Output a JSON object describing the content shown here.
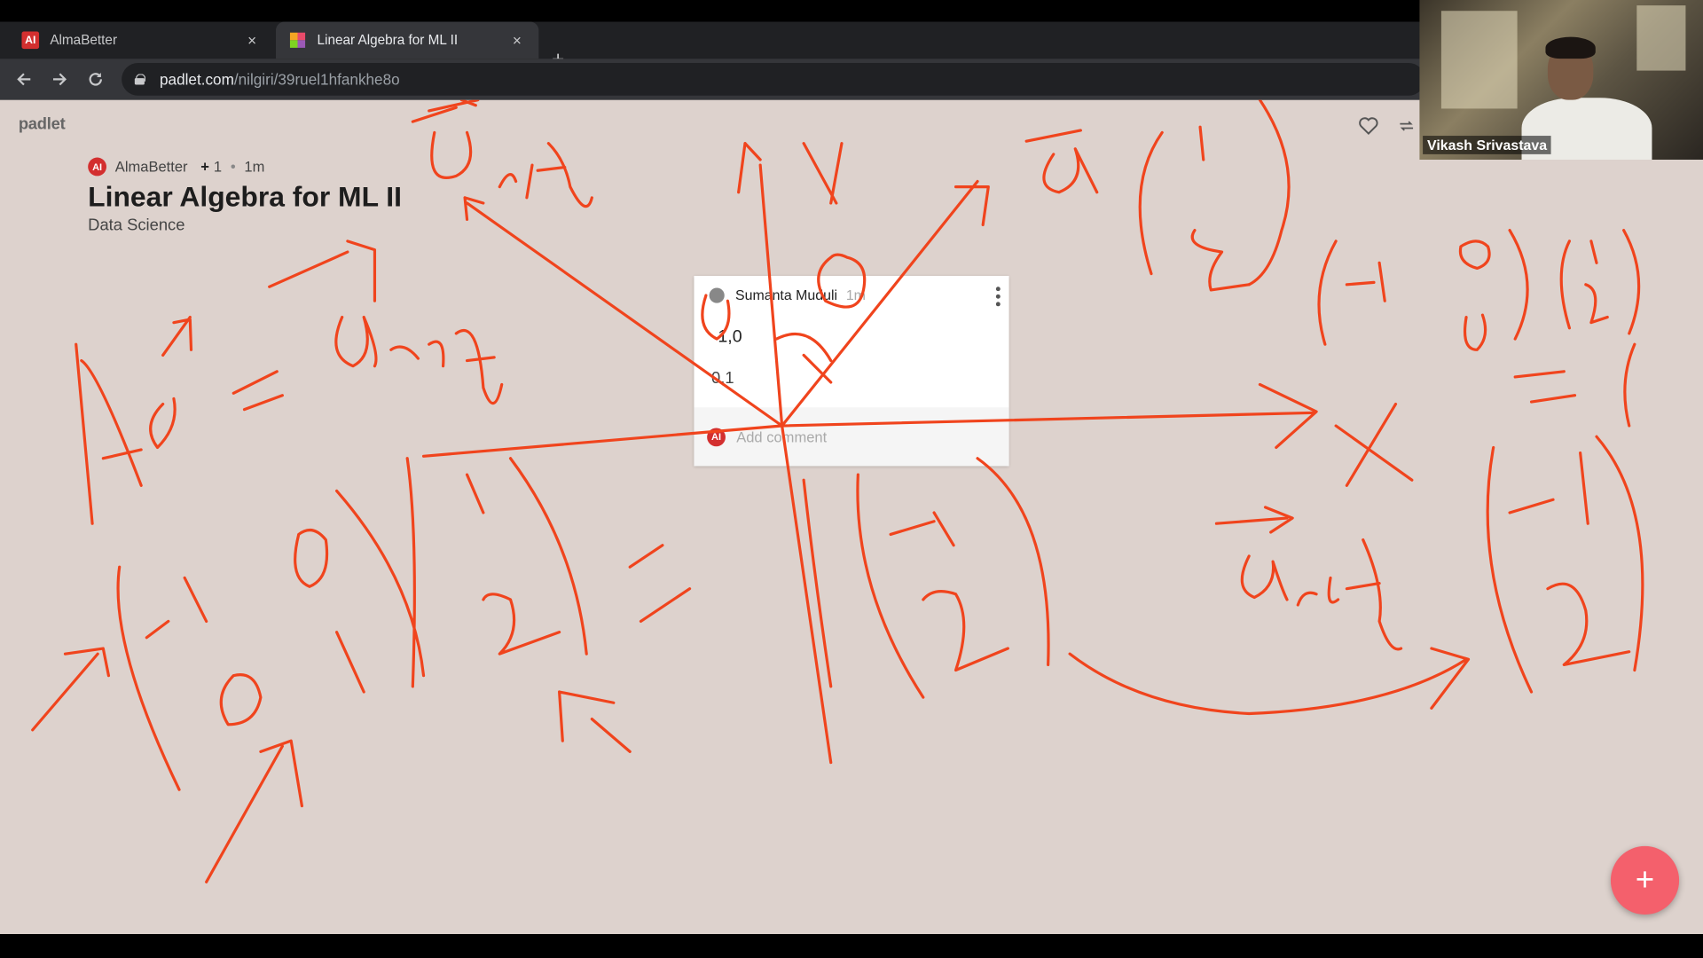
{
  "browser": {
    "tabs": [
      {
        "title": "AlmaBetter",
        "favicon": "almabetter-icon",
        "close": "×"
      },
      {
        "title": "Linear Algebra for ML II",
        "favicon": "padlet-icon",
        "close": "×"
      }
    ],
    "new_tab": "+",
    "url_host": "padlet.com",
    "url_path": "/nilgiri/39ruel1hfankhe8o"
  },
  "padlet": {
    "logo": "padlet",
    "author": "AlmaBetter",
    "author_badge": "AI",
    "contributors": "1",
    "time": "1m",
    "title": "Linear Algebra for ML II",
    "subtitle": "Data Science"
  },
  "card": {
    "author": "Sumanta Muduli",
    "time": "1m",
    "line1": "1,0",
    "line2": "0,1",
    "comment_placeholder": "Add comment",
    "comment_badge": "AI"
  },
  "fab": {
    "label": "+"
  },
  "webcam": {
    "name": "Vikash Srivastava"
  },
  "colors": {
    "ink": "#f0441d",
    "board_bg": "#ddd2cd",
    "fab": "#f4606c",
    "brand_red": "#d32f2f"
  }
}
